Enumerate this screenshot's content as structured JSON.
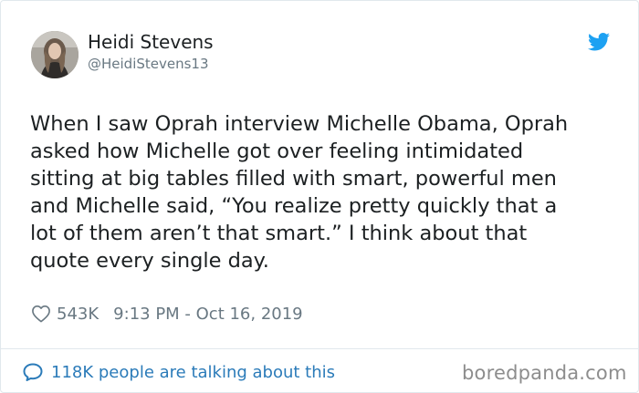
{
  "author": {
    "name": "Heidi Stevens",
    "handle": "@HeidiStevens13"
  },
  "tweet": {
    "text": "When I saw Oprah interview Michelle Obama, Oprah\nasked how Michelle got over feeling intimidated\nsitting at big tables filled with smart, powerful men\nand Michelle said, “You realize pretty quickly that a\nlot of them aren’t that smart.” I think about that\nquote every single day."
  },
  "meta": {
    "likes": "543K",
    "timestamp": "9:13 PM - Oct 16, 2019"
  },
  "footer": {
    "conversation_label": "118K people are talking about this"
  },
  "watermark": "boredpanda.com",
  "colors": {
    "twitter_blue": "#1da1f2",
    "link_blue": "#2b7bb9",
    "muted_gray": "#697882",
    "text": "#1c2022"
  },
  "icons": {
    "brand": "twitter-bird-icon",
    "like": "heart-outline-icon",
    "reply": "speech-bubble-icon"
  }
}
